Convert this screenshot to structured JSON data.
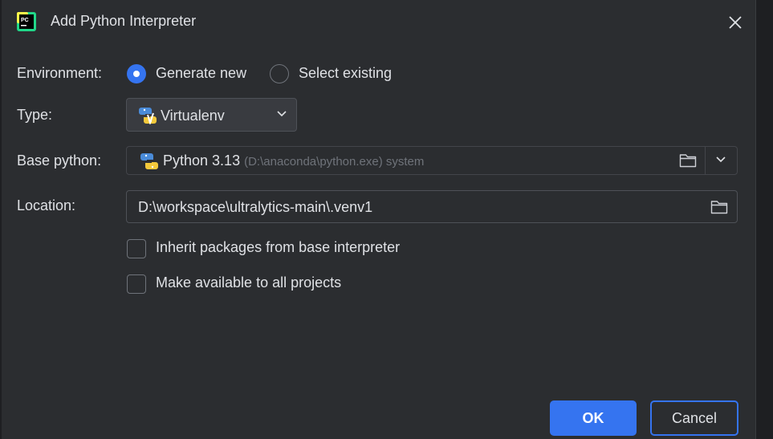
{
  "window": {
    "title": "Add Python Interpreter",
    "app_icon": "pycharm-logo",
    "logo_text": "PC",
    "close_icon": "close-icon"
  },
  "environment": {
    "label": "Environment:",
    "options": [
      {
        "label": "Generate new",
        "selected": true
      },
      {
        "label": "Select existing",
        "selected": false
      }
    ]
  },
  "type": {
    "label": "Type:",
    "value": "Virtualenv",
    "icon": "virtualenv-python-icon"
  },
  "base_python": {
    "label": "Base python:",
    "value": "Python 3.13",
    "detail": "(D:\\anaconda\\python.exe) system",
    "icon": "python-icon"
  },
  "location": {
    "label": "Location:",
    "value": "D:\\workspace\\ultralytics-main\\.venv1"
  },
  "options": {
    "inherit": {
      "label": "Inherit packages from base interpreter",
      "checked": false
    },
    "available": {
      "label": "Make available to all projects",
      "checked": false
    }
  },
  "buttons": {
    "ok": "OK",
    "cancel": "Cancel"
  },
  "colors": {
    "accent": "#3574f0",
    "background": "#2b2d30",
    "text": "#dfe1e5",
    "muted": "#6f737a"
  }
}
